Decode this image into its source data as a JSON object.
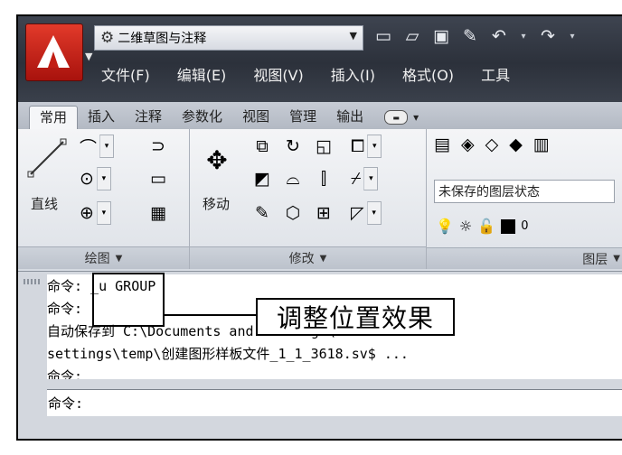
{
  "window": {
    "workspace": "二维草图与注释",
    "quick_access": [
      "new-icon",
      "open-icon",
      "save-icon",
      "saveas-icon",
      "undo-icon",
      "redo-icon"
    ]
  },
  "menu": [
    "文件(F)",
    "编辑(E)",
    "视图(V)",
    "插入(I)",
    "格式(O)",
    "工具"
  ],
  "tabs": [
    "常用",
    "插入",
    "注释",
    "参数化",
    "视图",
    "管理",
    "输出"
  ],
  "panels": {
    "draw": {
      "big_label": "直线",
      "footer": "绘图"
    },
    "modify": {
      "big_label": "移动",
      "footer": "修改"
    },
    "layers": {
      "state": "未保存的图层状态",
      "current_layer": "0",
      "footer": "图层"
    }
  },
  "command": {
    "history": [
      "命令: _u GROUP",
      "命令:",
      "自动保存到 C:\\Documents and Settings\\Administra",
      "settings\\temp\\创建图形样板文件_1_1_3618.sv$ ...",
      "命令:"
    ],
    "prompt": "命令:"
  },
  "annotation": {
    "label": "调整位置效果"
  },
  "colors": {
    "title_bg": "#2c313b",
    "logo_red": "#c21e14",
    "ribbon_bg": "#f4f5f7"
  }
}
